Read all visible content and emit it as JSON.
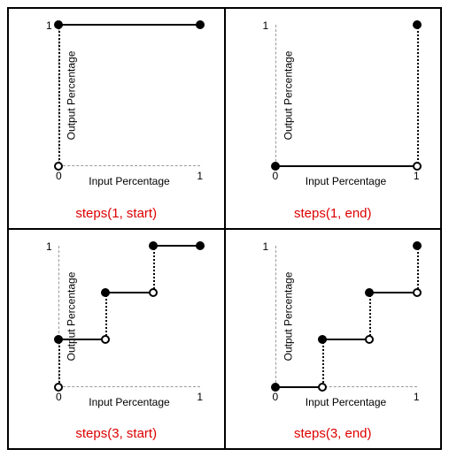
{
  "common": {
    "xlabel": "Input Percentage",
    "ylabel": "Output Percentage",
    "ticks": {
      "x0": "0",
      "x1": "1",
      "y0": "0",
      "y1": "1"
    }
  },
  "panels": [
    {
      "caption": "steps(1, start)"
    },
    {
      "caption": "steps(1, end)"
    },
    {
      "caption": "steps(3, start)"
    },
    {
      "caption": "steps(3, end)"
    }
  ],
  "chart_data": [
    {
      "type": "step",
      "title": "steps(1, start)",
      "xlabel": "Input Percentage",
      "ylabel": "Output Percentage",
      "xlim": [
        0,
        1
      ],
      "ylim": [
        0,
        1
      ],
      "segments": [
        {
          "x0": 0,
          "x1": 1,
          "y": 1
        }
      ],
      "points": [
        {
          "x": 0,
          "y": 0,
          "fill": "open"
        },
        {
          "x": 0,
          "y": 1,
          "fill": "filled"
        },
        {
          "x": 1,
          "y": 1,
          "fill": "filled"
        }
      ]
    },
    {
      "type": "step",
      "title": "steps(1, end)",
      "xlabel": "Input Percentage",
      "ylabel": "Output Percentage",
      "xlim": [
        0,
        1
      ],
      "ylim": [
        0,
        1
      ],
      "segments": [
        {
          "x0": 0,
          "x1": 1,
          "y": 0
        }
      ],
      "points": [
        {
          "x": 0,
          "y": 0,
          "fill": "filled"
        },
        {
          "x": 1,
          "y": 0,
          "fill": "open"
        },
        {
          "x": 1,
          "y": 1,
          "fill": "filled"
        }
      ]
    },
    {
      "type": "step",
      "title": "steps(3, start)",
      "xlabel": "Input Percentage",
      "ylabel": "Output Percentage",
      "xlim": [
        0,
        1
      ],
      "ylim": [
        0,
        1
      ],
      "segments": [
        {
          "x0": 0,
          "x1": 0.333333,
          "y": 0.333333
        },
        {
          "x0": 0.333333,
          "x1": 0.666667,
          "y": 0.666667
        },
        {
          "x0": 0.666667,
          "x1": 1,
          "y": 1
        }
      ],
      "points": [
        {
          "x": 0,
          "y": 0,
          "fill": "open"
        },
        {
          "x": 0,
          "y": 0.333333,
          "fill": "filled"
        },
        {
          "x": 0.333333,
          "y": 0.333333,
          "fill": "open"
        },
        {
          "x": 0.333333,
          "y": 0.666667,
          "fill": "filled"
        },
        {
          "x": 0.666667,
          "y": 0.666667,
          "fill": "open"
        },
        {
          "x": 0.666667,
          "y": 1,
          "fill": "filled"
        },
        {
          "x": 1,
          "y": 1,
          "fill": "filled"
        }
      ]
    },
    {
      "type": "step",
      "title": "steps(3, end)",
      "xlabel": "Input Percentage",
      "ylabel": "Output Percentage",
      "xlim": [
        0,
        1
      ],
      "ylim": [
        0,
        1
      ],
      "segments": [
        {
          "x0": 0,
          "x1": 0.333333,
          "y": 0
        },
        {
          "x0": 0.333333,
          "x1": 0.666667,
          "y": 0.333333
        },
        {
          "x0": 0.666667,
          "x1": 1,
          "y": 0.666667
        }
      ],
      "points": [
        {
          "x": 0,
          "y": 0,
          "fill": "filled"
        },
        {
          "x": 0.333333,
          "y": 0,
          "fill": "open"
        },
        {
          "x": 0.333333,
          "y": 0.333333,
          "fill": "filled"
        },
        {
          "x": 0.666667,
          "y": 0.333333,
          "fill": "open"
        },
        {
          "x": 0.666667,
          "y": 0.666667,
          "fill": "filled"
        },
        {
          "x": 1,
          "y": 0.666667,
          "fill": "open"
        },
        {
          "x": 1,
          "y": 1,
          "fill": "filled"
        }
      ]
    }
  ]
}
